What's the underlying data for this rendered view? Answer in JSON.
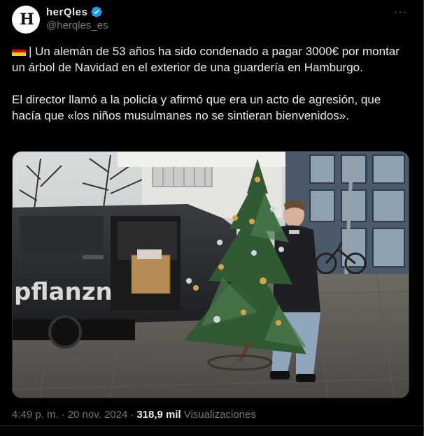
{
  "author": {
    "display_name": "herQles",
    "handle": "@herqles_es",
    "avatar_text": "H"
  },
  "tweet": {
    "flag_icon": "germany-flag-icon",
    "paragraph1": "| Un alemán de 53 años ha sido condenado a pagar 3000€ por montar un árbol de Navidad en el exterior de una guardería en Hamburgo.",
    "paragraph2": "El director llamó a la policía y afirmó que era un acto de agresión, que hacía que «los niños musulmanes no se sintieran bienvenidos».",
    "more_label": "···"
  },
  "media": {
    "van_text": "pflanzn"
  },
  "meta": {
    "time": "4:49 p. m.",
    "separator": "·",
    "date": "20 nov. 2024",
    "views_count": "318,9 mil",
    "views_label": "Visualizaciones"
  },
  "colors": {
    "background": "#000000",
    "text": "#e7e9ea",
    "secondary": "#71767b",
    "verified": "#1d9bf0",
    "flag": [
      "#000000",
      "#dd0000",
      "#ffce00"
    ]
  }
}
